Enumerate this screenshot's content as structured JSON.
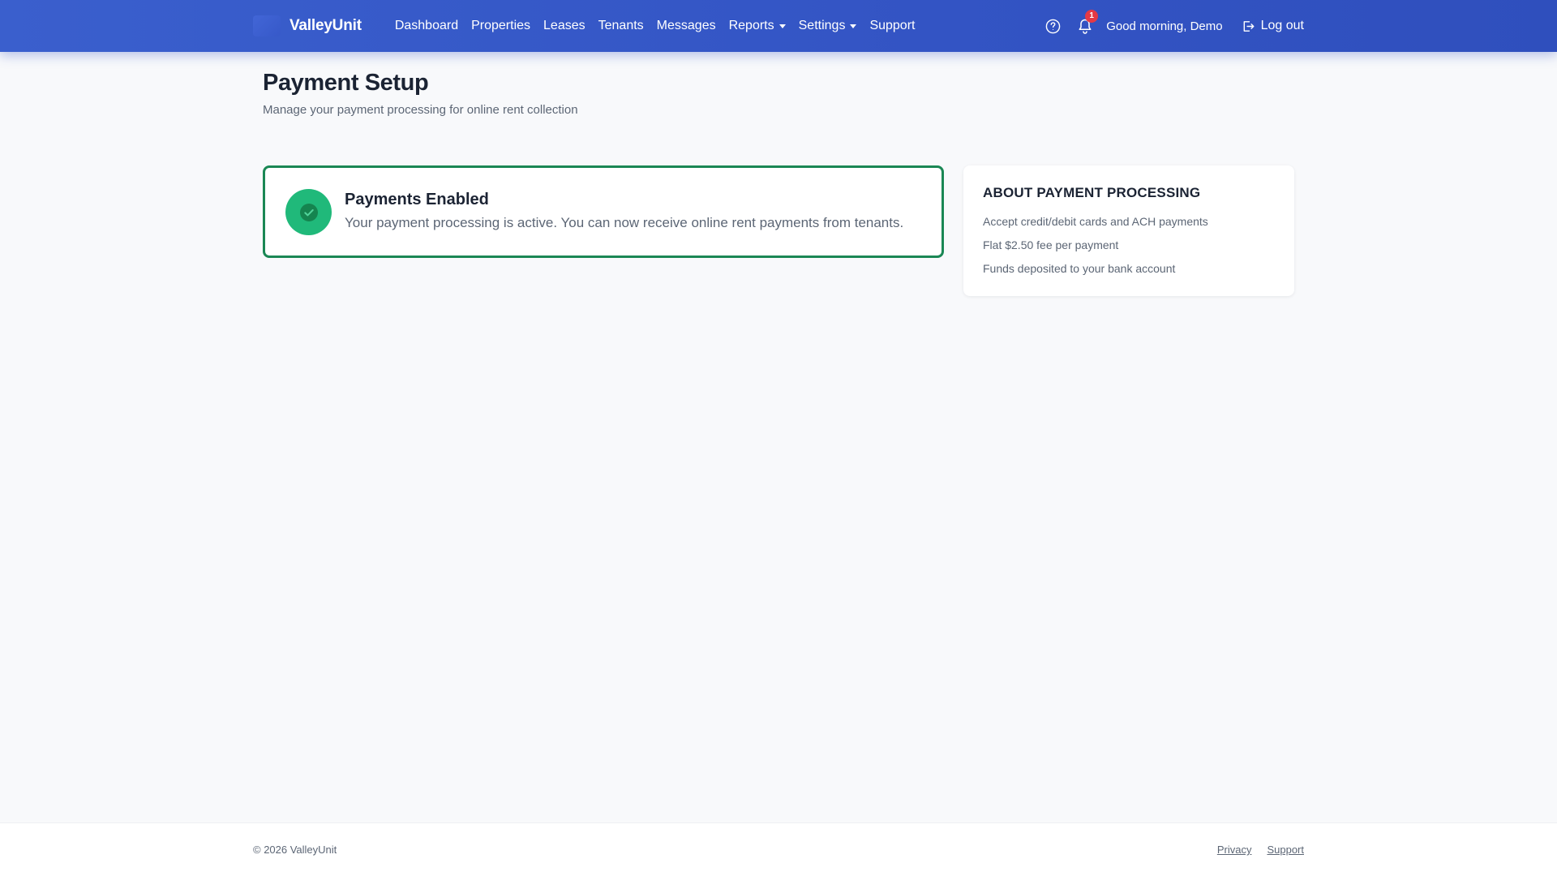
{
  "brand": {
    "name": "ValleyUnit"
  },
  "nav": {
    "items": [
      {
        "label": "Dashboard",
        "dropdown": false
      },
      {
        "label": "Properties",
        "dropdown": false
      },
      {
        "label": "Leases",
        "dropdown": false
      },
      {
        "label": "Tenants",
        "dropdown": false
      },
      {
        "label": "Messages",
        "dropdown": false
      },
      {
        "label": "Reports",
        "dropdown": true
      },
      {
        "label": "Settings",
        "dropdown": true
      },
      {
        "label": "Support",
        "dropdown": false
      }
    ],
    "help_icon": "question-circle-icon",
    "notifications": {
      "icon": "bell-icon",
      "count": "1"
    },
    "greeting": "Good morning, Demo",
    "logout_label": "Log out",
    "logout_icon": "logout-icon"
  },
  "page": {
    "title": "Payment Setup",
    "subtitle": "Manage your payment processing for online rent collection"
  },
  "status": {
    "icon": "check-circle-icon",
    "title": "Payments Enabled",
    "message": "Your payment processing is active. You can now receive online rent payments from tenants."
  },
  "about": {
    "title": "ABOUT PAYMENT PROCESSING",
    "items": [
      "Accept credit/debit cards and ACH payments",
      "Flat $2.50 fee per payment",
      "Funds deposited to your bank account"
    ]
  },
  "footer": {
    "copyright": "© 2026 ValleyUnit",
    "links": [
      "Privacy",
      "Support"
    ]
  },
  "colors": {
    "navbar": "#3354c4",
    "success_border": "#1a8754",
    "success_fill": "#20b97a",
    "badge": "#e53945",
    "page_background": "#f8f9fb"
  }
}
